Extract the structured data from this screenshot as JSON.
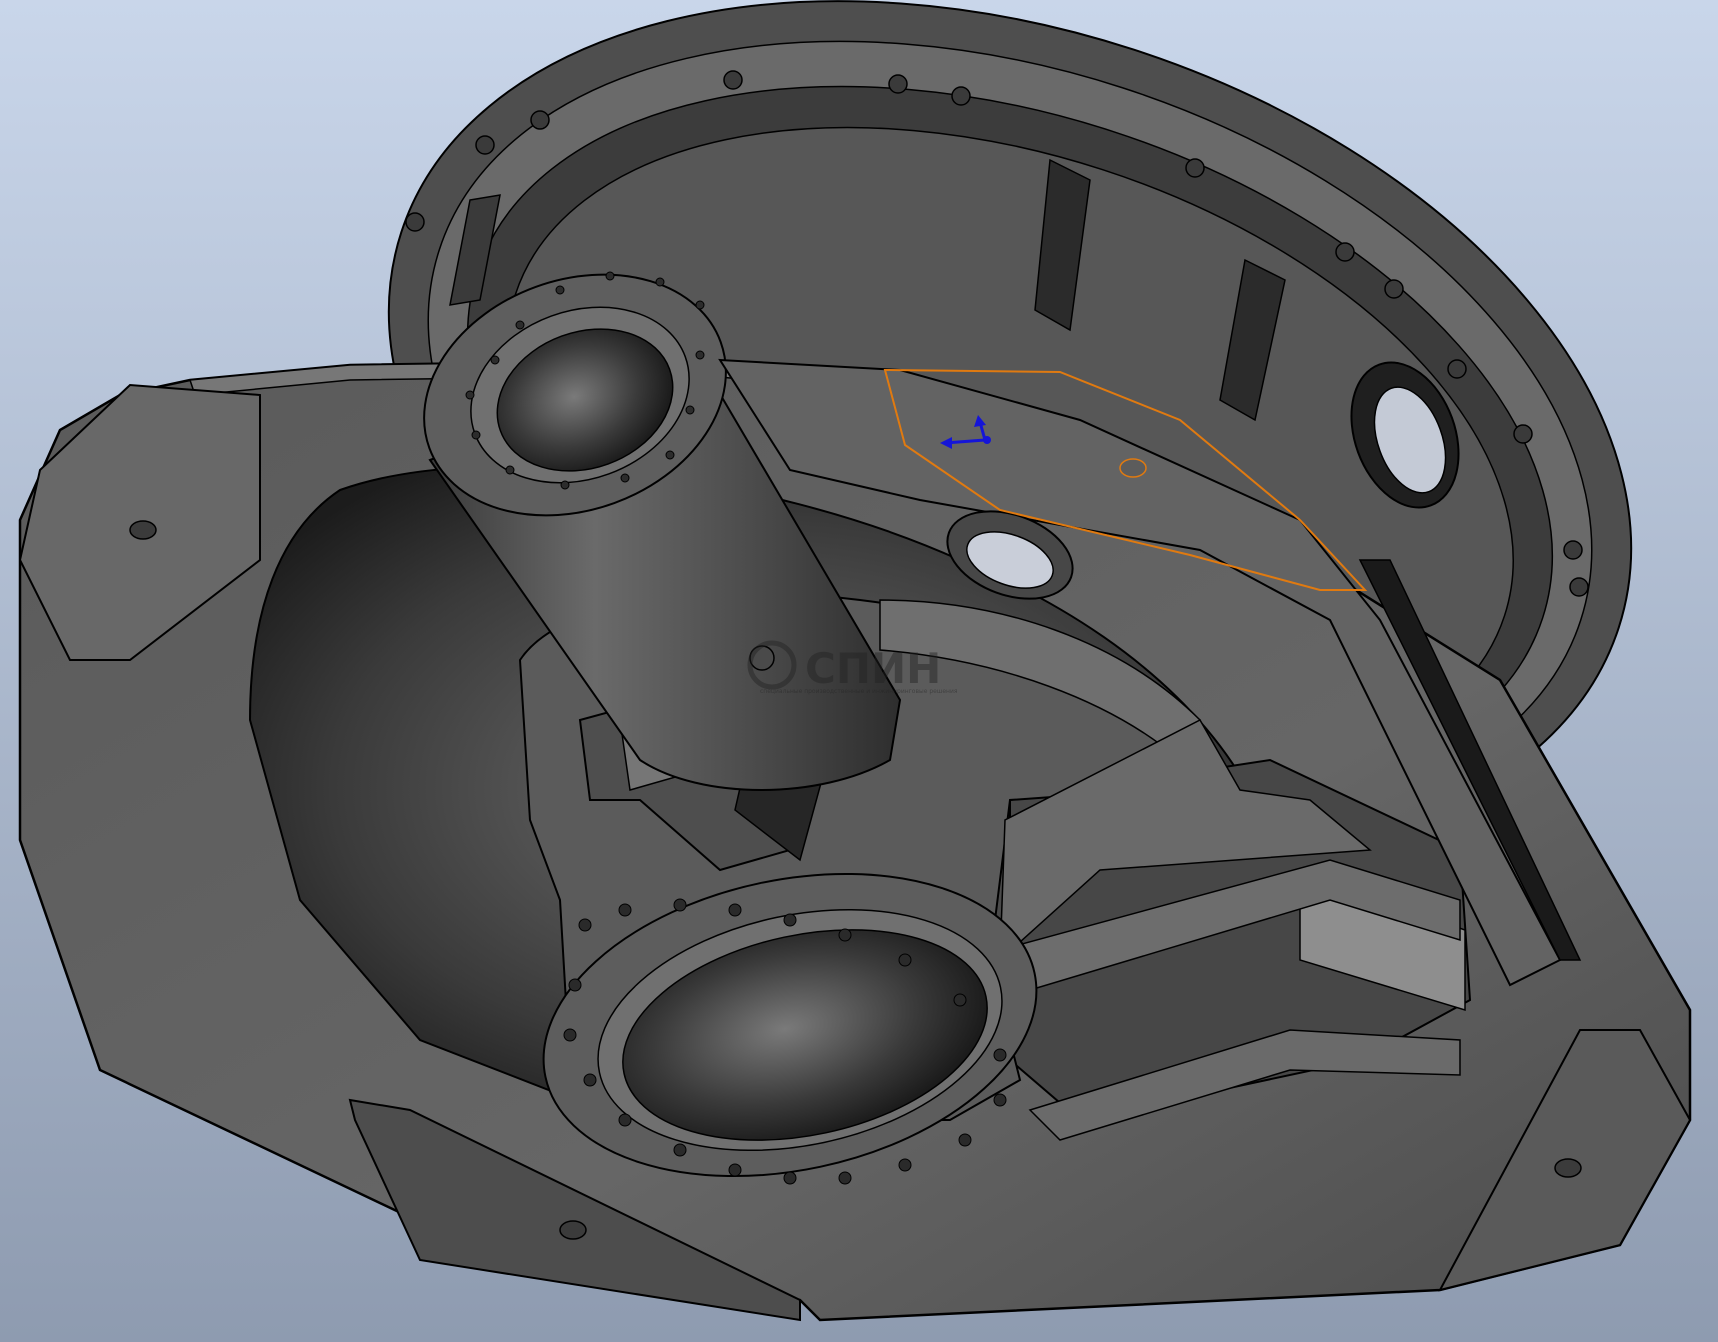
{
  "viewport": {
    "background_top": "#c9d6ea",
    "background_bottom": "#8e9bb0"
  },
  "model": {
    "body_color": "#5f5f5f",
    "edge_color": "#000000",
    "selection_color": "#e07a10",
    "triad_color": "#1515d8"
  },
  "watermark": {
    "logo": "СПИН",
    "tagline": "специальные производственные и инжиниринговые решения"
  }
}
